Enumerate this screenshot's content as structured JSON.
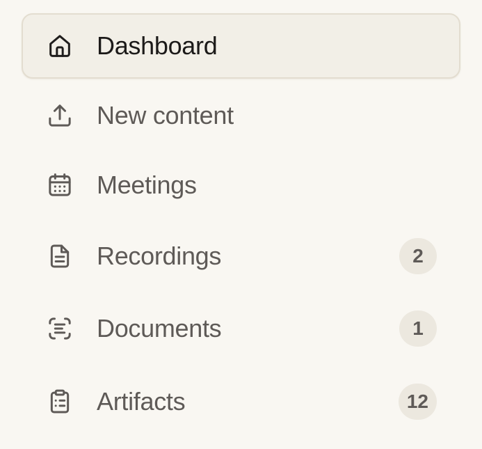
{
  "sidebar": {
    "items": [
      {
        "label": "Dashboard",
        "icon": "home-icon",
        "active": true
      },
      {
        "label": "New content",
        "icon": "upload-icon"
      },
      {
        "label": "Meetings",
        "icon": "calendar-icon"
      },
      {
        "label": "Recordings",
        "icon": "document-icon",
        "badge": "2"
      },
      {
        "label": "Documents",
        "icon": "scan-text-icon",
        "badge": "1"
      },
      {
        "label": "Artifacts",
        "icon": "clipboard-list-icon",
        "badge": "12"
      }
    ]
  },
  "colors": {
    "background": "#f9f7f2",
    "active_background": "#f2efe7",
    "active_border": "#e3ddd0",
    "text": "#5e5a57",
    "active_text": "#1c1a19",
    "badge_background": "#ece8df"
  }
}
